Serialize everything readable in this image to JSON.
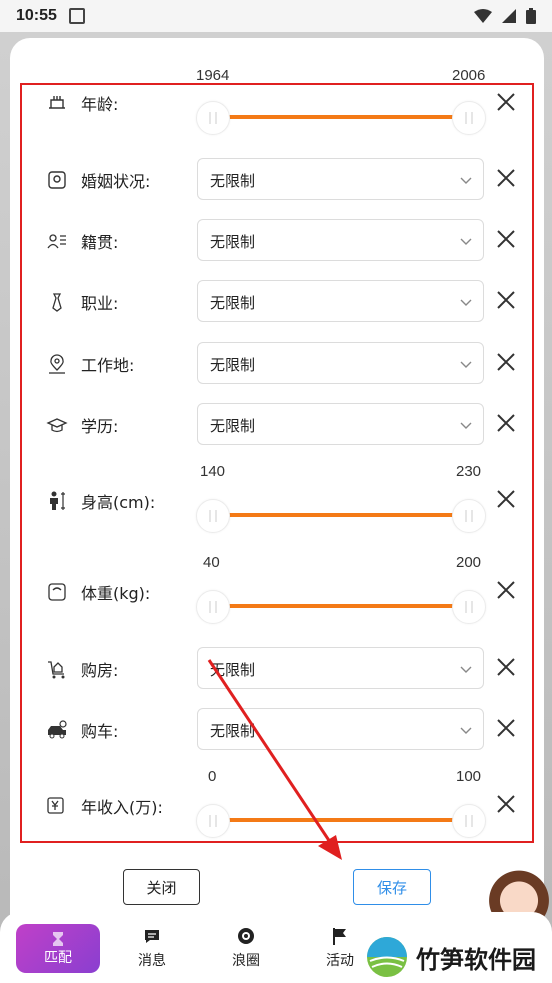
{
  "status_bar": {
    "time": "10:55"
  },
  "filters": [
    {
      "label": "年龄:",
      "type": "range",
      "min": "1964",
      "max": "2006"
    },
    {
      "label": "婚姻状况:",
      "type": "select",
      "value": "无限制"
    },
    {
      "label": "籍贯:",
      "type": "select",
      "value": "无限制"
    },
    {
      "label": "职业:",
      "type": "select",
      "value": "无限制"
    },
    {
      "label": "工作地:",
      "type": "select",
      "value": "无限制"
    },
    {
      "label": "学历:",
      "type": "select",
      "value": "无限制"
    },
    {
      "label": "身高(cm):",
      "type": "range",
      "min": "140",
      "max": "230"
    },
    {
      "label": "体重(kg):",
      "type": "range",
      "min": "40",
      "max": "200"
    },
    {
      "label": "购房:",
      "type": "select",
      "value": "无限制"
    },
    {
      "label": "购车:",
      "type": "select",
      "value": "无限制"
    },
    {
      "label": "年收入(万):",
      "type": "range",
      "min": "0",
      "max": "100"
    }
  ],
  "buttons": {
    "close": "关闭",
    "save": "保存"
  },
  "tabs": [
    {
      "label": "匹配",
      "icon": "hourglass-icon"
    },
    {
      "label": "消息",
      "icon": "chat-icon"
    },
    {
      "label": "浪圈",
      "icon": "circle-icon"
    },
    {
      "label": "活动",
      "icon": "flag-icon"
    }
  ],
  "watermark": "竹笋软件园",
  "colors": {
    "accent": "#f47a16",
    "save": "#2f8ee8",
    "annotation": "#e02020"
  }
}
